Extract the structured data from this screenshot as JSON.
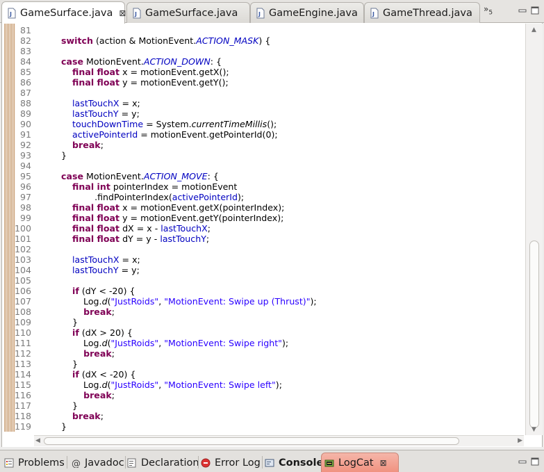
{
  "editor_tabs": [
    {
      "label": "GameSurface.java",
      "active": true,
      "icon": "java-file-icon",
      "close": "⊠"
    },
    {
      "label": "GameSurface.java",
      "active": false,
      "icon": "java-file-icon"
    },
    {
      "label": "GameEngine.java",
      "active": false,
      "icon": "java-file-icon"
    },
    {
      "label": "GameThread.java",
      "active": false,
      "icon": "java-file-icon"
    }
  ],
  "overflow": {
    "symbol": "»",
    "count": "5"
  },
  "code": {
    "line_numbers": [
      "81",
      "82",
      "83",
      "84",
      "85",
      "86",
      "87",
      "88",
      "89",
      "90",
      "91",
      "92",
      "93",
      "94",
      "95",
      "96",
      "97",
      "98",
      "99",
      "100",
      "101",
      "102",
      "103",
      "104",
      "105",
      "106",
      "107",
      "108",
      "109",
      "110",
      "111",
      "112",
      "113",
      "114",
      "115",
      "116",
      "117",
      "118",
      "119"
    ],
    "lines": [
      [
        {
          "t": "      "
        }
      ],
      [
        {
          "t": "        "
        },
        {
          "t": "switch",
          "c": "kw"
        },
        {
          "t": " (action & MotionEvent."
        },
        {
          "t": "ACTION_MASK",
          "c": "sfld"
        },
        {
          "t": ") {"
        }
      ],
      [
        {
          "t": ""
        }
      ],
      [
        {
          "t": "        "
        },
        {
          "t": "case",
          "c": "kw"
        },
        {
          "t": " MotionEvent."
        },
        {
          "t": "ACTION_DOWN",
          "c": "sfld"
        },
        {
          "t": ": {"
        }
      ],
      [
        {
          "t": "            "
        },
        {
          "t": "final float",
          "c": "kw"
        },
        {
          "t": " x = motionEvent.getX();"
        }
      ],
      [
        {
          "t": "            "
        },
        {
          "t": "final float",
          "c": "kw"
        },
        {
          "t": " y = motionEvent.getY();"
        }
      ],
      [
        {
          "t": ""
        }
      ],
      [
        {
          "t": "            "
        },
        {
          "t": "lastTouchX",
          "c": "fld"
        },
        {
          "t": " = x;"
        }
      ],
      [
        {
          "t": "            "
        },
        {
          "t": "lastTouchY",
          "c": "fld"
        },
        {
          "t": " = y;"
        }
      ],
      [
        {
          "t": "            "
        },
        {
          "t": "touchDownTime",
          "c": "fld"
        },
        {
          "t": " = System."
        },
        {
          "t": "currentTimeMillis",
          "c": "smeth"
        },
        {
          "t": "();"
        }
      ],
      [
        {
          "t": "            "
        },
        {
          "t": "activePointerId",
          "c": "fld"
        },
        {
          "t": " = motionEvent.getPointerId(0);"
        }
      ],
      [
        {
          "t": "            "
        },
        {
          "t": "break",
          "c": "kw"
        },
        {
          "t": ";"
        }
      ],
      [
        {
          "t": "        }"
        }
      ],
      [
        {
          "t": ""
        }
      ],
      [
        {
          "t": "        "
        },
        {
          "t": "case",
          "c": "kw"
        },
        {
          "t": " MotionEvent."
        },
        {
          "t": "ACTION_MOVE",
          "c": "sfld"
        },
        {
          "t": ": {"
        }
      ],
      [
        {
          "t": "            "
        },
        {
          "t": "final int",
          "c": "kw"
        },
        {
          "t": " pointerIndex = motionEvent"
        }
      ],
      [
        {
          "t": "                    .findPointerIndex("
        },
        {
          "t": "activePointerId",
          "c": "fld"
        },
        {
          "t": ");"
        }
      ],
      [
        {
          "t": "            "
        },
        {
          "t": "final float",
          "c": "kw"
        },
        {
          "t": " x = motionEvent.getX(pointerIndex);"
        }
      ],
      [
        {
          "t": "            "
        },
        {
          "t": "final float",
          "c": "kw"
        },
        {
          "t": " y = motionEvent.getY(pointerIndex);"
        }
      ],
      [
        {
          "t": "            "
        },
        {
          "t": "final float",
          "c": "kw"
        },
        {
          "t": " dX = x - "
        },
        {
          "t": "lastTouchX",
          "c": "fld"
        },
        {
          "t": ";"
        }
      ],
      [
        {
          "t": "            "
        },
        {
          "t": "final float",
          "c": "kw"
        },
        {
          "t": " dY = y - "
        },
        {
          "t": "lastTouchY",
          "c": "fld"
        },
        {
          "t": ";"
        }
      ],
      [
        {
          "t": ""
        }
      ],
      [
        {
          "t": "            "
        },
        {
          "t": "lastTouchX",
          "c": "fld"
        },
        {
          "t": " = x;"
        }
      ],
      [
        {
          "t": "            "
        },
        {
          "t": "lastTouchY",
          "c": "fld"
        },
        {
          "t": " = y;"
        }
      ],
      [
        {
          "t": ""
        }
      ],
      [
        {
          "t": "            "
        },
        {
          "t": "if",
          "c": "kw"
        },
        {
          "t": " (dY < -20) {"
        }
      ],
      [
        {
          "t": "                Log."
        },
        {
          "t": "d",
          "c": "smeth"
        },
        {
          "t": "("
        },
        {
          "t": "\"JustRoids\"",
          "c": "str"
        },
        {
          "t": ", "
        },
        {
          "t": "\"MotionEvent: Swipe up (Thrust)\"",
          "c": "str"
        },
        {
          "t": ");"
        }
      ],
      [
        {
          "t": "                "
        },
        {
          "t": "break",
          "c": "kw"
        },
        {
          "t": ";"
        }
      ],
      [
        {
          "t": "            }"
        }
      ],
      [
        {
          "t": "            "
        },
        {
          "t": "if",
          "c": "kw"
        },
        {
          "t": " (dX > 20) {"
        }
      ],
      [
        {
          "t": "                Log."
        },
        {
          "t": "d",
          "c": "smeth"
        },
        {
          "t": "("
        },
        {
          "t": "\"JustRoids\"",
          "c": "str"
        },
        {
          "t": ", "
        },
        {
          "t": "\"MotionEvent: Swipe right\"",
          "c": "str"
        },
        {
          "t": ");"
        }
      ],
      [
        {
          "t": "                "
        },
        {
          "t": "break",
          "c": "kw"
        },
        {
          "t": ";"
        }
      ],
      [
        {
          "t": "            }"
        }
      ],
      [
        {
          "t": "            "
        },
        {
          "t": "if",
          "c": "kw"
        },
        {
          "t": " (dX < -20) {"
        }
      ],
      [
        {
          "t": "                Log."
        },
        {
          "t": "d",
          "c": "smeth"
        },
        {
          "t": "("
        },
        {
          "t": "\"JustRoids\"",
          "c": "str"
        },
        {
          "t": ", "
        },
        {
          "t": "\"MotionEvent: Swipe left\"",
          "c": "str"
        },
        {
          "t": ");"
        }
      ],
      [
        {
          "t": "                "
        },
        {
          "t": "break",
          "c": "kw"
        },
        {
          "t": ";"
        }
      ],
      [
        {
          "t": "            }"
        }
      ],
      [
        {
          "t": "            "
        },
        {
          "t": "break",
          "c": "kw"
        },
        {
          "t": ";"
        }
      ],
      [
        {
          "t": "        }"
        }
      ]
    ]
  },
  "view_tabs": [
    {
      "label": "Problems",
      "icon": "problems-icon",
      "active": false
    },
    {
      "label": "Javadoc",
      "icon": "javadoc-icon",
      "active": false
    },
    {
      "label": "Declaration",
      "icon": "declaration-icon",
      "active": false
    },
    {
      "label": "Error Log",
      "icon": "error-log-icon",
      "active": false
    },
    {
      "label": "Console",
      "icon": "console-icon",
      "active": false,
      "bold": true
    },
    {
      "label": "LogCat",
      "icon": "logcat-icon",
      "active": true,
      "close": "⊠"
    }
  ],
  "colors": {
    "keyword": "#7f0055",
    "field": "#0000c0",
    "string": "#2a00ff",
    "active_view_tab": "#f0917f"
  }
}
